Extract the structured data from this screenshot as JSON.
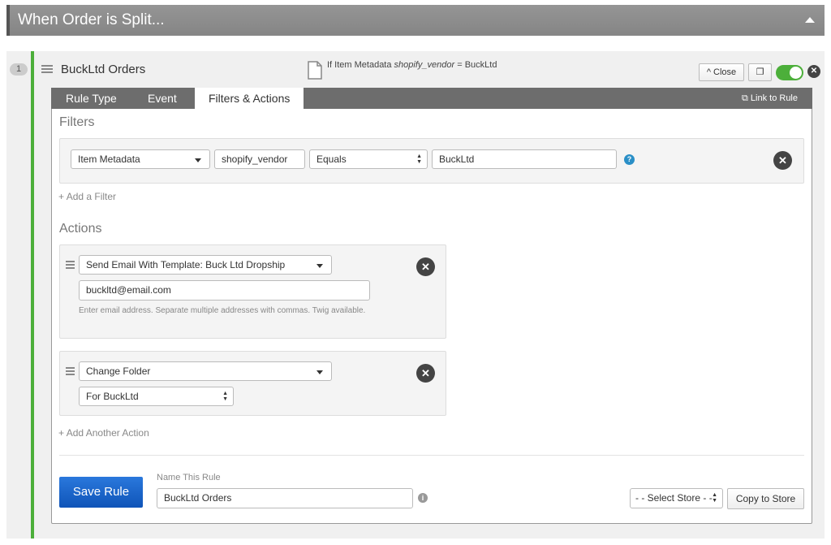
{
  "header": {
    "title": "When Order is Split..."
  },
  "rule": {
    "index": "1",
    "title": "BuckLtd Orders",
    "summary_prefix": "If Item Metadata ",
    "summary_key": "shopify_vendor",
    "summary_suffix": " = BuckLtd",
    "close_label": "Close",
    "enabled": true
  },
  "tabs": [
    {
      "label": "Rule Type"
    },
    {
      "label": "Event"
    },
    {
      "label": "Filters & Actions",
      "active": true
    }
  ],
  "link_to_rule": "Link to Rule",
  "filters": {
    "heading": "Filters",
    "field": "Item Metadata",
    "key": "shopify_vendor",
    "operator": "Equals",
    "value": "BuckLtd",
    "add_label": "Add a Filter"
  },
  "actions": {
    "heading": "Actions",
    "items": [
      {
        "type": "Send Email With Template: Buck Ltd Dropship",
        "email": "buckltd@email.com",
        "help": "Enter email address. Separate multiple addresses with commas. Twig available."
      },
      {
        "type": "Change Folder",
        "folder": "For BuckLtd"
      }
    ],
    "add_label": "Add Another Action"
  },
  "footer": {
    "save_label": "Save Rule",
    "name_label": "Name This Rule",
    "name_value": "BuckLtd Orders",
    "store_select": "- - Select Store - -",
    "copy_label": "Copy to Store"
  },
  "colors": {
    "accent_green": "#4caf3a",
    "save_blue": "#1a62c8",
    "tab_bar": "#6d6d6d"
  }
}
